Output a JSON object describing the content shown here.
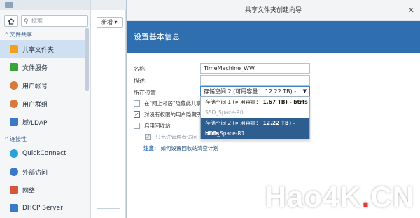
{
  "search": {
    "placeholder": "搜索"
  },
  "sidebar": {
    "sections": [
      {
        "label": "文件共享"
      },
      {
        "label": "连接性"
      }
    ],
    "items": [
      {
        "label": "共享文件夹",
        "color": "#f0a020"
      },
      {
        "label": "文件服务",
        "color": "#3aa33a"
      },
      {
        "label": "用户帐号",
        "color": "#d77a3a"
      },
      {
        "label": "用户群组",
        "color": "#d77a3a"
      },
      {
        "label": "域/LDAP",
        "color": "#3a78c8"
      },
      {
        "label": "QuickConnect",
        "color": "#2aa2d8"
      },
      {
        "label": "外部访问",
        "color": "#3a78c8"
      },
      {
        "label": "网络",
        "color": "#d9553a"
      },
      {
        "label": "DHCP Server",
        "color": "#3a78c8"
      }
    ]
  },
  "toolbar": {
    "new_label": "新增"
  },
  "wizard": {
    "title": "共享文件夹创建向导",
    "header": "设置基本信息",
    "name_label": "名称:",
    "name_value": "TimeMachine_WW",
    "desc_label": "描述:",
    "desc_value": "",
    "location_label": "所在位置:",
    "location_value": "存储空间 2 (可用容量： 12.22 TB) - btrfs",
    "checkbox1_label": "在\"网上邻居\"隐藏此共享文件",
    "checkbox2_label": "对没有权限的用户隐藏子文件",
    "checkbox3_label": "启用回收站",
    "checkbox4_label": "只允许管理者访问",
    "note_label": "注意:",
    "note_link": "如何设置回收站清空计划"
  },
  "dropdown": {
    "options": [
      {
        "prefix": "存储空间 1 (可用容量：",
        "bold": " 1.67 TB) - btrfs",
        "state": "normal"
      },
      {
        "prefix": "SSD_Space-R0",
        "bold": "",
        "state": "disabled"
      },
      {
        "prefix": "存储空间 2 (可用容量：",
        "bold": " 12.22 TB) - btrfs",
        "state": "selected"
      },
      {
        "prefix": "HDD_Space-R1",
        "bold": "",
        "state": "selected"
      }
    ]
  },
  "watermark": {
    "part1": "Hao4K",
    "dot": ".",
    "part2": "CN"
  }
}
